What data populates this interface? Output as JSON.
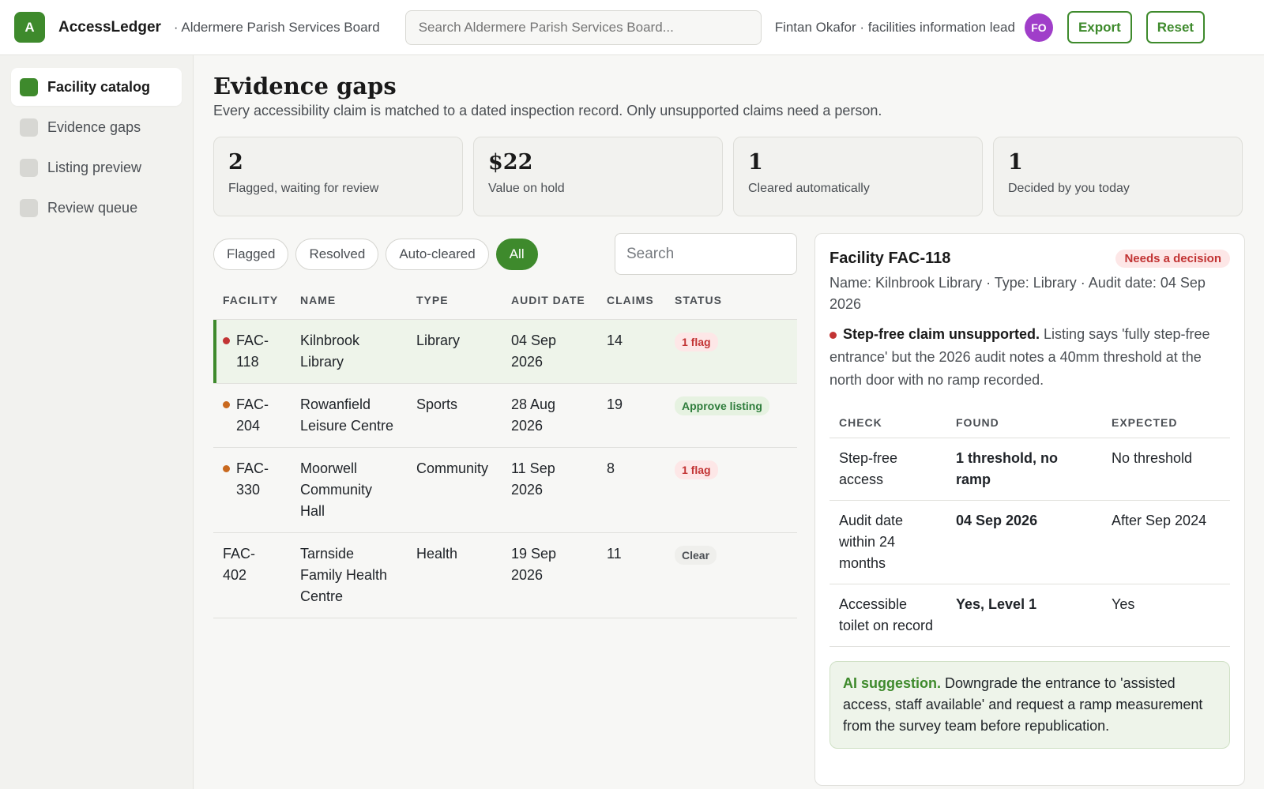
{
  "header": {
    "logo_letter": "A",
    "app_name": "AccessLedger",
    "org_name": "· Aldermere Parish Services Board",
    "search_placeholder": "Search Aldermere Parish Services Board...",
    "user": "Fintan Okafor · facilities information lead",
    "avatar_initials": "FO",
    "export_label": "Export",
    "reset_label": "Reset"
  },
  "sidebar": {
    "items": [
      {
        "label": "Facility catalog",
        "active": true
      },
      {
        "label": "Evidence gaps",
        "active": false
      },
      {
        "label": "Listing preview",
        "active": false
      },
      {
        "label": "Review queue",
        "active": false
      }
    ]
  },
  "page": {
    "title": "Evidence gaps",
    "subtitle": "Every accessibility claim is matched to a dated inspection record. Only unsupported claims need a person."
  },
  "stats": [
    {
      "value": "2",
      "label": "Flagged, waiting for review"
    },
    {
      "value": "$22",
      "label": "Value on hold"
    },
    {
      "value": "1",
      "label": "Cleared automatically"
    },
    {
      "value": "1",
      "label": "Decided by you today"
    }
  ],
  "filters": {
    "chips": [
      "Flagged",
      "Resolved",
      "Auto-cleared",
      "All"
    ],
    "active": "All",
    "search_placeholder": "Search"
  },
  "table": {
    "headers": [
      "FACILITY",
      "NAME",
      "TYPE",
      "AUDIT DATE",
      "CLAIMS",
      "STATUS"
    ],
    "rows": [
      {
        "id_line1": "FAC-",
        "id_line2": "118",
        "name": "Kilnbrook Library",
        "type": "Library",
        "date": "04 Sep 2026",
        "claims": "14",
        "status": "1 flag",
        "status_kind": "flag",
        "dot": "#c23434",
        "selected": true
      },
      {
        "id_line1": "FAC-",
        "id_line2": "204",
        "name": "Rowanfield Leisure Centre",
        "type": "Sports",
        "date": "28 Aug 2026",
        "claims": "19",
        "status": "Approve listing",
        "status_kind": "approve",
        "dot": "#c9691f",
        "selected": false
      },
      {
        "id_line1": "FAC-",
        "id_line2": "330",
        "name": "Moorwell Community Hall",
        "type": "Community",
        "date": "11 Sep 2026",
        "claims": "8",
        "status": "1 flag",
        "status_kind": "flag",
        "dot": "#c9691f",
        "selected": false
      },
      {
        "id_line1": "FAC-",
        "id_line2": "402",
        "name": "Tarnside Family Health Centre",
        "type": "Health",
        "date": "19 Sep 2026",
        "claims": "11",
        "status": "Clear",
        "status_kind": "clear",
        "dot": "",
        "selected": false
      }
    ]
  },
  "detail": {
    "title": "Facility FAC-118",
    "badge": "Needs a decision",
    "meta": "Name: Kilnbrook Library · Type: Library · Audit date: 04 Sep 2026",
    "issue_title": "Step-free claim unsupported.",
    "issue_text": " Listing says 'fully step-free entrance' but the 2026 audit notes a 40mm threshold at the north door with no ramp recorded.",
    "checks_headers": [
      "CHECK",
      "FOUND",
      "EXPECTED"
    ],
    "checks": [
      {
        "check": "Step-free access",
        "found": "1 threshold, no ramp",
        "found_kind": "bad",
        "expected": "No threshold"
      },
      {
        "check": "Audit date within 24 months",
        "found": "04 Sep 2026",
        "found_kind": "good",
        "expected": "After Sep 2024"
      },
      {
        "check": "Accessible toilet on record",
        "found": "Yes, Level 1",
        "found_kind": "good",
        "expected": "Yes"
      }
    ],
    "ai_label": "AI suggestion.",
    "ai_text": " Downgrade the entrance to 'assisted access, staff available' and request a ramp measurement from the survey team before republication."
  },
  "colors": {
    "brand": "#3e8a2c",
    "danger": "#c23434",
    "warning": "#c9691f",
    "avatar": "#a03ec9"
  }
}
